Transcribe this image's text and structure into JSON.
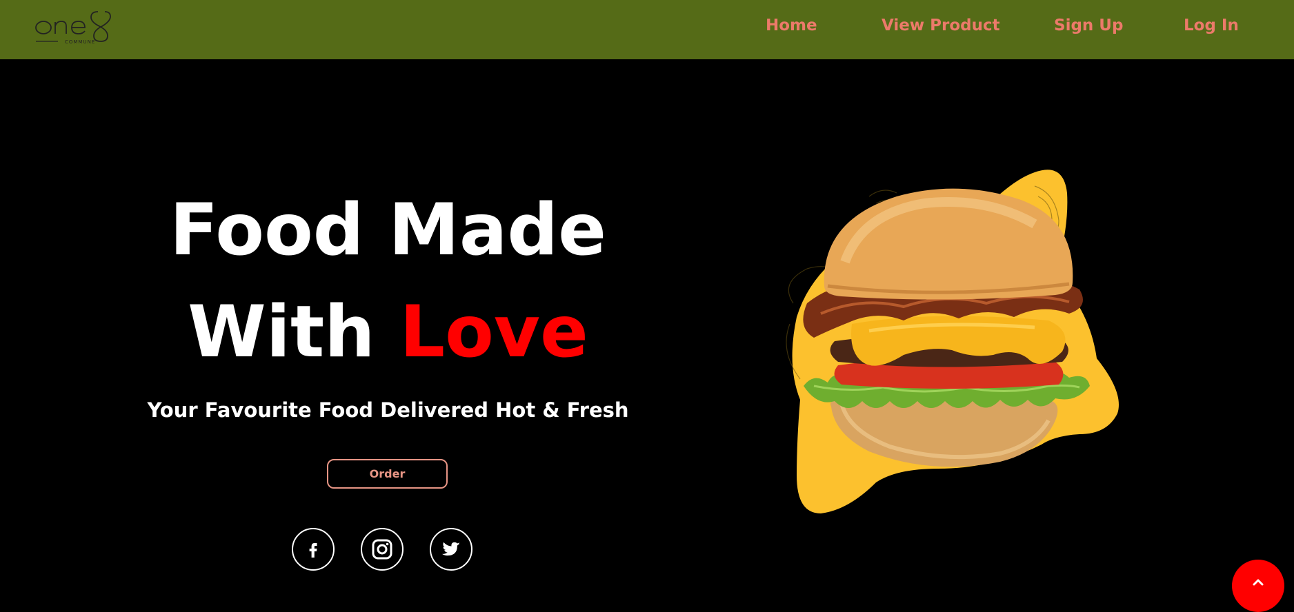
{
  "brand": {
    "logo_text": "one8",
    "logo_subtext": "COMMUNE",
    "nav_bg": "#556b17"
  },
  "nav": {
    "links": [
      "Home",
      "View Product",
      "Sign Up",
      "Log In"
    ],
    "link_color": "#ec7a6a"
  },
  "hero": {
    "title_line1": "Food Made",
    "title_line2_white": "With",
    "title_line2_accent": "Love",
    "subtitle": "Your Favourite Food Delivered Hot & Fresh",
    "order_button": "Order",
    "accent_color": "#ff0000"
  },
  "social": {
    "icons": [
      "facebook-icon",
      "instagram-icon",
      "twitter-icon"
    ]
  },
  "scroll_top": {
    "icon": "chevron-up-icon"
  }
}
